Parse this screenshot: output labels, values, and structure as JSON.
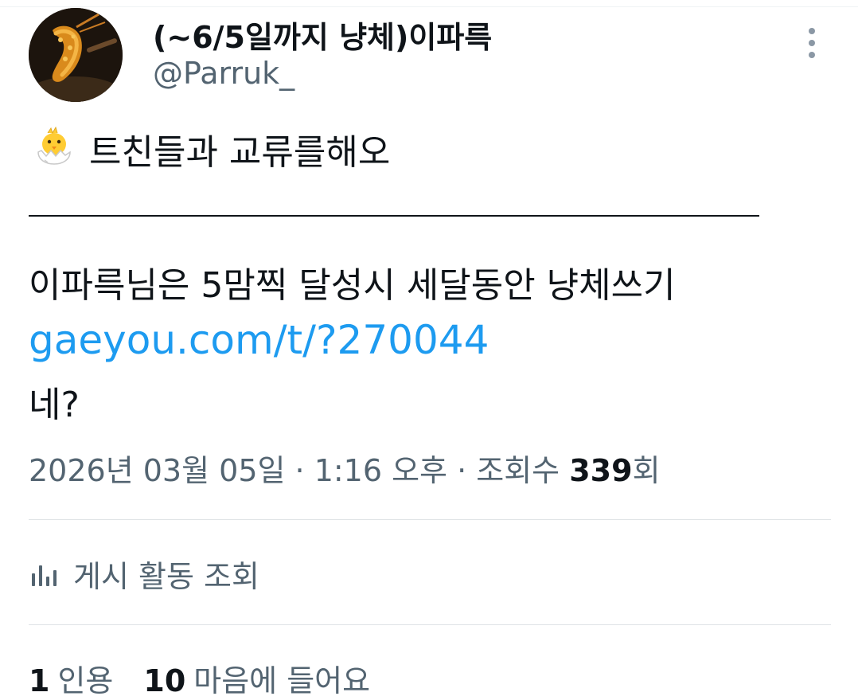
{
  "profile": {
    "display_name": "(~6/5일까지 냥체)이파륵",
    "handle": "@Parruk_"
  },
  "post": {
    "bio_emoji": "hatching-chick-icon",
    "bio_text": "트친들과 교류를해오",
    "line1": "이파륵님은 5맘찍 달성시 세달동안 냥체쓰기",
    "link": "gaeyou.com/t/?270044",
    "line3": "네?"
  },
  "meta": {
    "timestamp": "2026년 03월 05일 · 1:16 오후 · 조회수 ",
    "views_count": "339",
    "views_suffix": "회"
  },
  "activity": {
    "icon": "bar-chart-icon",
    "label": "게시 활동 조회"
  },
  "stats": {
    "quotes_count": "1",
    "quotes_label": "인용",
    "likes_count": "10",
    "likes_label": "마음에 들어요"
  },
  "colors": {
    "link": "#1d9bf0",
    "muted": "#536471",
    "text": "#0f1419"
  }
}
